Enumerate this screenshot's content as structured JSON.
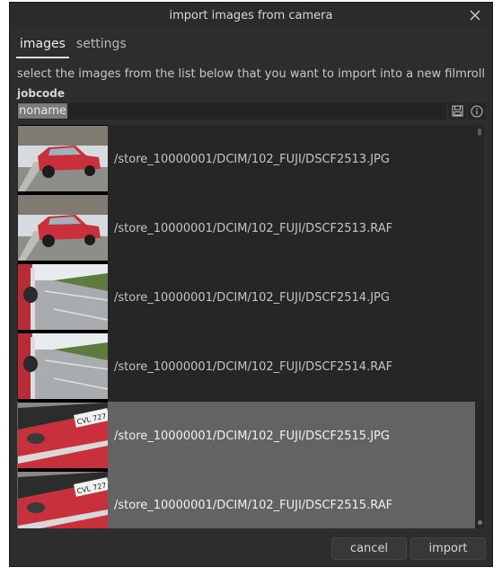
{
  "window": {
    "title": "import images from camera",
    "close_icon": "close-x-icon"
  },
  "tabs": [
    {
      "label": "images",
      "active": true
    },
    {
      "label": "settings",
      "active": false
    }
  ],
  "instructions": "select the images from the list below that you want to import into a new filmroll",
  "jobcode": {
    "label": "jobcode",
    "value": "noname",
    "save_icon": "save-preset-icon",
    "info_icon": "info-icon"
  },
  "files": [
    {
      "path": "/store_10000001/DCIM/102_FUJI/DSCF2513.JPG",
      "selected": false,
      "thumb": "red-car-side"
    },
    {
      "path": "/store_10000001/DCIM/102_FUJI/DSCF2513.RAF",
      "selected": false,
      "thumb": "red-car-side"
    },
    {
      "path": "/store_10000001/DCIM/102_FUJI/DSCF2514.JPG",
      "selected": false,
      "thumb": "car-mirror-road"
    },
    {
      "path": "/store_10000001/DCIM/102_FUJI/DSCF2514.RAF",
      "selected": false,
      "thumb": "car-mirror-road"
    },
    {
      "path": "/store_10000001/DCIM/102_FUJI/DSCF2515.JPG",
      "selected": true,
      "thumb": "car-plate-closeup"
    },
    {
      "path": "/store_10000001/DCIM/102_FUJI/DSCF2515.RAF",
      "selected": true,
      "thumb": "car-plate-closeup"
    }
  ],
  "plate_text": "CVL 727",
  "buttons": {
    "cancel": "cancel",
    "import": "import"
  },
  "colors": {
    "dialog_bg": "#2d2d2d",
    "selected_row": "#636363",
    "car_red": "#c8303b"
  }
}
